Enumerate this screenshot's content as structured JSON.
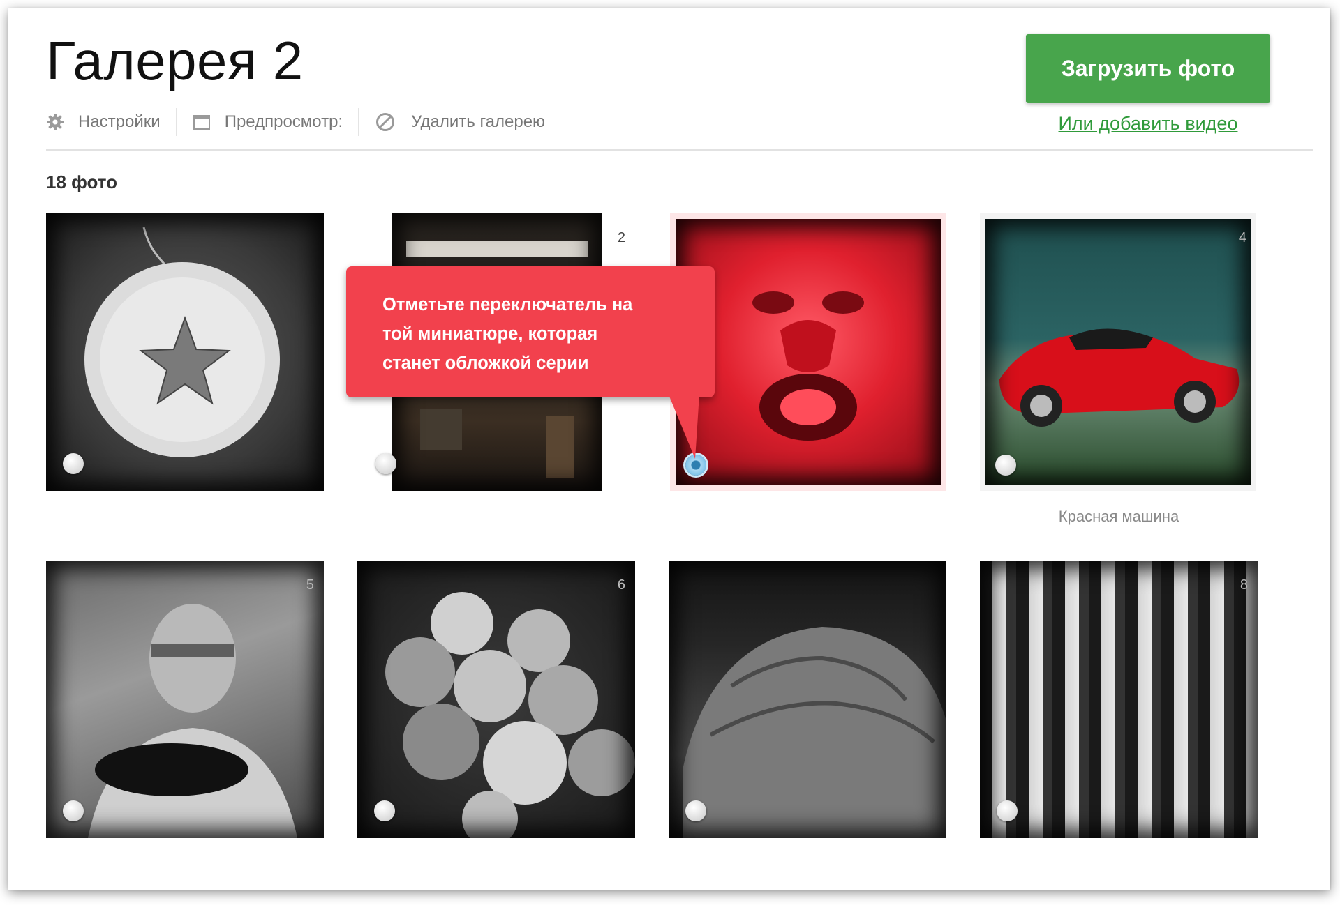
{
  "gallery": {
    "title": "Галерея 2",
    "photo_count_label": "18 фото"
  },
  "toolbar": {
    "settings_label": "Настройки",
    "preview_label": "Предпросмотр:",
    "delete_label": "Удалить галерею"
  },
  "actions": {
    "upload_label": "Загрузить фото",
    "add_video_label": "Или добавить видео",
    "accent_color": "#48a54c"
  },
  "tooltip": {
    "text_line1": "Отметьте переключатель на",
    "text_line2": "той миниатюре, которая",
    "text_line3": "станет обложкой серии",
    "color": "#f2414d"
  },
  "photos": [
    {
      "number": "",
      "subject": "star-ornament-plate",
      "cover": false,
      "caption": ""
    },
    {
      "number": "2",
      "subject": "dark-interior",
      "cover": false,
      "caption": ""
    },
    {
      "number": "",
      "subject": "red-lion-head",
      "cover": true,
      "caption": ""
    },
    {
      "number": "4",
      "subject": "red-sports-car",
      "cover": false,
      "caption": "Красная машина"
    },
    {
      "number": "5",
      "subject": "man-with-cat",
      "cover": false,
      "caption": ""
    },
    {
      "number": "6",
      "subject": "apples",
      "cover": false,
      "caption": ""
    },
    {
      "number": "",
      "subject": "tortoise-shell",
      "cover": false,
      "caption": ""
    },
    {
      "number": "8",
      "subject": "curtains",
      "cover": false,
      "caption": ""
    }
  ]
}
